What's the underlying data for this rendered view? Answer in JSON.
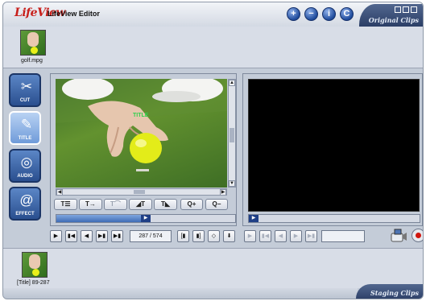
{
  "app": {
    "logo": "LifeView",
    "title": "LifeView Editor",
    "controls": [
      "+",
      "−",
      "i",
      "C"
    ],
    "original_clips_label": "Original Clips",
    "staging_clips_label": "Staging Clips"
  },
  "original_clips": [
    {
      "label": "golf.mpg"
    }
  ],
  "staging_clips": [
    {
      "label": "[Title] 89-287"
    }
  ],
  "sidebar": {
    "items": [
      {
        "label": "CUT",
        "icon": "scissors-icon",
        "active": false
      },
      {
        "label": "TITLE",
        "icon": "pen-icon",
        "active": true
      },
      {
        "label": "AUDIO",
        "icon": "speaker-icon",
        "active": false
      },
      {
        "label": "EFFECT",
        "icon": "swirl-icon",
        "active": false
      }
    ]
  },
  "editor": {
    "title_tools": [
      {
        "label": "T☰",
        "enabled": true
      },
      {
        "label": "T→",
        "enabled": true
      },
      {
        "label": "T⌒",
        "enabled": false
      },
      {
        "label": "◢T",
        "enabled": true
      },
      {
        "label": "T◣",
        "enabled": true
      },
      {
        "label": "Q+",
        "enabled": true
      },
      {
        "label": "Q−",
        "enabled": true
      }
    ],
    "overlay_text": "TITLE",
    "seek_fraction": 0.5
  },
  "preview": {
    "seek_fraction": 0.02
  },
  "transport": {
    "frame_counter": "287 / 574"
  },
  "colors": {
    "accent": "#2a4f8f",
    "logo": "#c8201c",
    "record": "#d0160f"
  }
}
